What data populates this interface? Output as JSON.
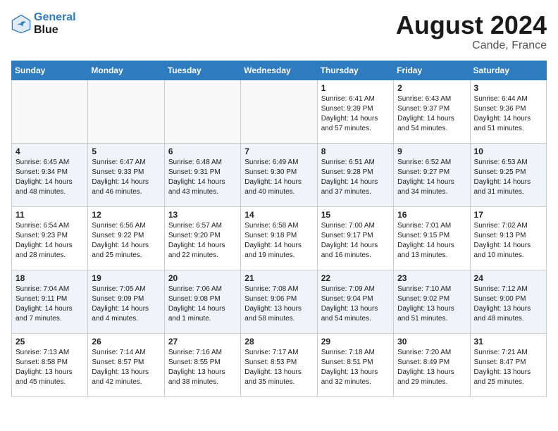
{
  "logo": {
    "line1": "General",
    "line2": "Blue"
  },
  "title": "August 2024",
  "location": "Cande, France",
  "days_header": [
    "Sunday",
    "Monday",
    "Tuesday",
    "Wednesday",
    "Thursday",
    "Friday",
    "Saturday"
  ],
  "weeks": [
    [
      {
        "day": "",
        "content": ""
      },
      {
        "day": "",
        "content": ""
      },
      {
        "day": "",
        "content": ""
      },
      {
        "day": "",
        "content": ""
      },
      {
        "day": "1",
        "content": "Sunrise: 6:41 AM\nSunset: 9:39 PM\nDaylight: 14 hours\nand 57 minutes."
      },
      {
        "day": "2",
        "content": "Sunrise: 6:43 AM\nSunset: 9:37 PM\nDaylight: 14 hours\nand 54 minutes."
      },
      {
        "day": "3",
        "content": "Sunrise: 6:44 AM\nSunset: 9:36 PM\nDaylight: 14 hours\nand 51 minutes."
      }
    ],
    [
      {
        "day": "4",
        "content": "Sunrise: 6:45 AM\nSunset: 9:34 PM\nDaylight: 14 hours\nand 48 minutes."
      },
      {
        "day": "5",
        "content": "Sunrise: 6:47 AM\nSunset: 9:33 PM\nDaylight: 14 hours\nand 46 minutes."
      },
      {
        "day": "6",
        "content": "Sunrise: 6:48 AM\nSunset: 9:31 PM\nDaylight: 14 hours\nand 43 minutes."
      },
      {
        "day": "7",
        "content": "Sunrise: 6:49 AM\nSunset: 9:30 PM\nDaylight: 14 hours\nand 40 minutes."
      },
      {
        "day": "8",
        "content": "Sunrise: 6:51 AM\nSunset: 9:28 PM\nDaylight: 14 hours\nand 37 minutes."
      },
      {
        "day": "9",
        "content": "Sunrise: 6:52 AM\nSunset: 9:27 PM\nDaylight: 14 hours\nand 34 minutes."
      },
      {
        "day": "10",
        "content": "Sunrise: 6:53 AM\nSunset: 9:25 PM\nDaylight: 14 hours\nand 31 minutes."
      }
    ],
    [
      {
        "day": "11",
        "content": "Sunrise: 6:54 AM\nSunset: 9:23 PM\nDaylight: 14 hours\nand 28 minutes."
      },
      {
        "day": "12",
        "content": "Sunrise: 6:56 AM\nSunset: 9:22 PM\nDaylight: 14 hours\nand 25 minutes."
      },
      {
        "day": "13",
        "content": "Sunrise: 6:57 AM\nSunset: 9:20 PM\nDaylight: 14 hours\nand 22 minutes."
      },
      {
        "day": "14",
        "content": "Sunrise: 6:58 AM\nSunset: 9:18 PM\nDaylight: 14 hours\nand 19 minutes."
      },
      {
        "day": "15",
        "content": "Sunrise: 7:00 AM\nSunset: 9:17 PM\nDaylight: 14 hours\nand 16 minutes."
      },
      {
        "day": "16",
        "content": "Sunrise: 7:01 AM\nSunset: 9:15 PM\nDaylight: 14 hours\nand 13 minutes."
      },
      {
        "day": "17",
        "content": "Sunrise: 7:02 AM\nSunset: 9:13 PM\nDaylight: 14 hours\nand 10 minutes."
      }
    ],
    [
      {
        "day": "18",
        "content": "Sunrise: 7:04 AM\nSunset: 9:11 PM\nDaylight: 14 hours\nand 7 minutes."
      },
      {
        "day": "19",
        "content": "Sunrise: 7:05 AM\nSunset: 9:09 PM\nDaylight: 14 hours\nand 4 minutes."
      },
      {
        "day": "20",
        "content": "Sunrise: 7:06 AM\nSunset: 9:08 PM\nDaylight: 14 hours\nand 1 minute."
      },
      {
        "day": "21",
        "content": "Sunrise: 7:08 AM\nSunset: 9:06 PM\nDaylight: 13 hours\nand 58 minutes."
      },
      {
        "day": "22",
        "content": "Sunrise: 7:09 AM\nSunset: 9:04 PM\nDaylight: 13 hours\nand 54 minutes."
      },
      {
        "day": "23",
        "content": "Sunrise: 7:10 AM\nSunset: 9:02 PM\nDaylight: 13 hours\nand 51 minutes."
      },
      {
        "day": "24",
        "content": "Sunrise: 7:12 AM\nSunset: 9:00 PM\nDaylight: 13 hours\nand 48 minutes."
      }
    ],
    [
      {
        "day": "25",
        "content": "Sunrise: 7:13 AM\nSunset: 8:58 PM\nDaylight: 13 hours\nand 45 minutes."
      },
      {
        "day": "26",
        "content": "Sunrise: 7:14 AM\nSunset: 8:57 PM\nDaylight: 13 hours\nand 42 minutes."
      },
      {
        "day": "27",
        "content": "Sunrise: 7:16 AM\nSunset: 8:55 PM\nDaylight: 13 hours\nand 38 minutes."
      },
      {
        "day": "28",
        "content": "Sunrise: 7:17 AM\nSunset: 8:53 PM\nDaylight: 13 hours\nand 35 minutes."
      },
      {
        "day": "29",
        "content": "Sunrise: 7:18 AM\nSunset: 8:51 PM\nDaylight: 13 hours\nand 32 minutes."
      },
      {
        "day": "30",
        "content": "Sunrise: 7:20 AM\nSunset: 8:49 PM\nDaylight: 13 hours\nand 29 minutes."
      },
      {
        "day": "31",
        "content": "Sunrise: 7:21 AM\nSunset: 8:47 PM\nDaylight: 13 hours\nand 25 minutes."
      }
    ]
  ]
}
